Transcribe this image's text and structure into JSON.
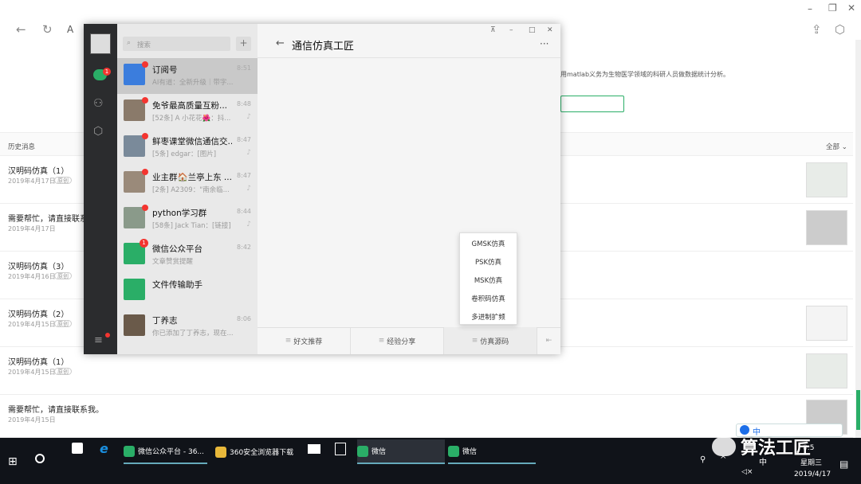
{
  "browser": {
    "url_prefix": "A"
  },
  "background": {
    "desc_snippet": "用matlab义务为生物医学领域的科研人员做数据统计分析。",
    "history_label": "历史消息",
    "filter_label": "全部",
    "rows": [
      {
        "title": "汉明码仿真（1）",
        "date": "2019年4月17日",
        "tag": "原创"
      },
      {
        "title": "需要帮忙，请直接联系我。",
        "date": "2019年4月17日",
        "tag": ""
      },
      {
        "title": "汉明码仿真（3）",
        "date": "2019年4月16日",
        "tag": "原创"
      },
      {
        "title": "汉明码仿真（2）",
        "date": "2019年4月15日",
        "tag": "原创"
      },
      {
        "title": "汉明码仿真（1）",
        "date": "2019年4月15日",
        "tag": "原创"
      },
      {
        "title": "需要帮忙，请直接联系我。",
        "date": "2019年4月15日",
        "tag": ""
      }
    ]
  },
  "wechat": {
    "search_placeholder": "搜索",
    "add_label": "+",
    "chat_title": "通信仿真工匠",
    "more_label": "···",
    "window_controls": {
      "pin": "⊼",
      "min": "–",
      "max": "□",
      "close": "✕"
    },
    "chats": [
      {
        "name": "订阅号",
        "preview": "AI有道：全新升级｜带字...",
        "time": "8:51",
        "badge": true,
        "color": "#3b7ddd"
      },
      {
        "name": "免爷最高质量互粉...",
        "preview": "[52条] A 小花花🌺：抖...",
        "time": "8:48",
        "badge": true,
        "color": "#8a7a6a"
      },
      {
        "name": "鲜枣课堂微信通信交...",
        "preview": "[5条] edgar：[图片]",
        "time": "8:47",
        "badge": true,
        "color": "#7a8a9a"
      },
      {
        "name": "业主群🏠兰亭上东 ...",
        "preview": "[2条] A2309：\"南余临...",
        "time": "8:47",
        "badge": true,
        "color": "#9a8a7a"
      },
      {
        "name": "python学习群",
        "preview": "[58条] Jack Tian：[链接]",
        "time": "8:44",
        "badge": true,
        "color": "#8a9a8a"
      },
      {
        "name": "微信公众平台",
        "preview": "文章赞赏提醒",
        "time": "8:42",
        "badge": true,
        "color": "#2aae67"
      },
      {
        "name": "文件传输助手",
        "preview": "",
        "time": "",
        "badge": false,
        "color": "#2aae67"
      },
      {
        "name": "丁养志",
        "preview": "你已添加了丁养志，现在...",
        "time": "8:06",
        "badge": false,
        "color": "#6a5a4a"
      }
    ],
    "menu_tabs": [
      "好文推荐",
      "经验分享",
      "仿真源码"
    ],
    "submenu": [
      "GMSK仿真",
      "PSK仿真",
      "MSK仿真",
      "卷积码仿真",
      "多进制扩频"
    ],
    "rail_badge": "1",
    "pub_badge": "1"
  },
  "taskbar": {
    "apps": [
      "微信公众平台 - 36...",
      "360安全浏览器下载",
      "微信",
      "微信"
    ],
    "tray_lang": "中",
    "time": "8:5",
    "weekday": "星期三",
    "date": "2019/4/17"
  },
  "watermark": "算法工匠",
  "colors": {
    "wechat_green": "#2aae67",
    "badge_red": "#f43530",
    "rail": "#2b2c2e"
  }
}
